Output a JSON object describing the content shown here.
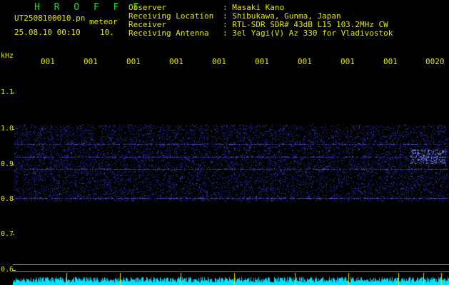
{
  "header": {
    "app_title": "H R O F F T",
    "file_name": "UT2508100010.pn",
    "meteor_label": "meteor",
    "timestamp": "25.08.10 00:10",
    "interval": "10."
  },
  "station_info": [
    {
      "label": "Observer",
      "value": ": Masaki Kano"
    },
    {
      "label": "Receiving Location",
      "value": ": Shibukawa, Gunma, Japan"
    },
    {
      "label": "Receiver",
      "value": ": RTL-SDR SDR# 43dB L15 103.2MHz CW"
    },
    {
      "label": "Receiving Antenna",
      "value": ": 3el Yagi(V) Az 330 for Vladivostok"
    }
  ],
  "y_axis": {
    "unit": "kHz",
    "ticks": [
      "1.1",
      "1.0",
      "0.9",
      "0.8",
      "0.7",
      "0.6"
    ]
  },
  "x_axis": {
    "ticks": [
      "001",
      "001",
      "001",
      "001",
      "001",
      "001",
      "001",
      "001",
      "001",
      "0020"
    ]
  },
  "colors": {
    "noise": "#2a2aff",
    "label": "#e6e600",
    "title": "#1ee11e",
    "strip": "#00e0ff"
  }
}
